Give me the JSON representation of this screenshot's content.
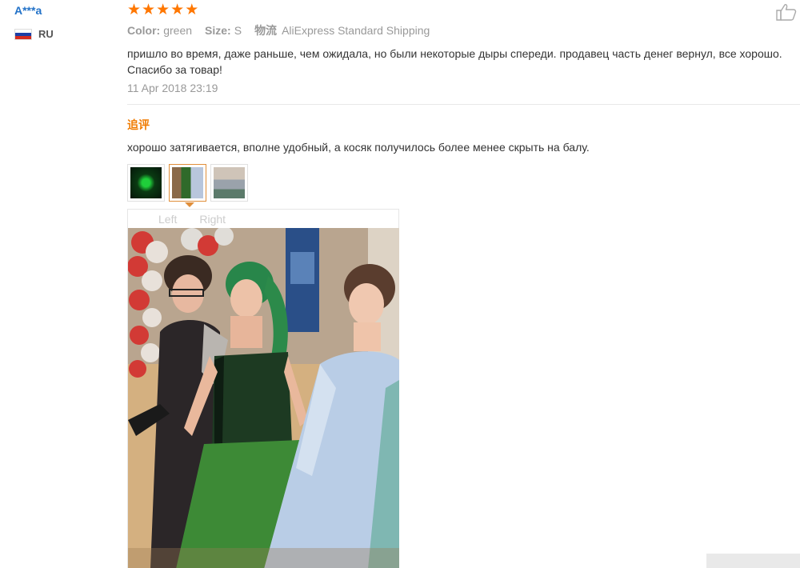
{
  "reviewer": {
    "name": "A***a",
    "country_code": "RU",
    "flag_colors": [
      "#ffffff",
      "#1c3fa6",
      "#d52b1e"
    ]
  },
  "review": {
    "rating": 5,
    "star_char": "★",
    "color_label": "Color:",
    "color_value": "green",
    "size_label": "Size:",
    "size_value": "S",
    "shipping_label": "物流",
    "shipping_value": "AliExpress Standard Shipping",
    "text": "пришло во время, даже раньше, чем ожидала, но были некоторые дыры спереди. продавец часть денег вернул, все хорошо. Спасибо за товар!",
    "date": "11 Apr 2018 23:19"
  },
  "followup": {
    "title": "追评",
    "text": "хорошо затягивается, вполне удобный, а косяк получилось более менее скрыть на балу.",
    "thumbnails": [
      {
        "id": "thumb-1",
        "active": false
      },
      {
        "id": "thumb-2",
        "active": true
      },
      {
        "id": "thumb-3",
        "active": false
      }
    ]
  },
  "viewer": {
    "left_label": "Left",
    "right_label": "Right"
  },
  "colors": {
    "accent_orange": "#f07b00",
    "star_orange": "#ff7700",
    "link_blue": "#2272c8",
    "muted_gray": "#999999"
  }
}
